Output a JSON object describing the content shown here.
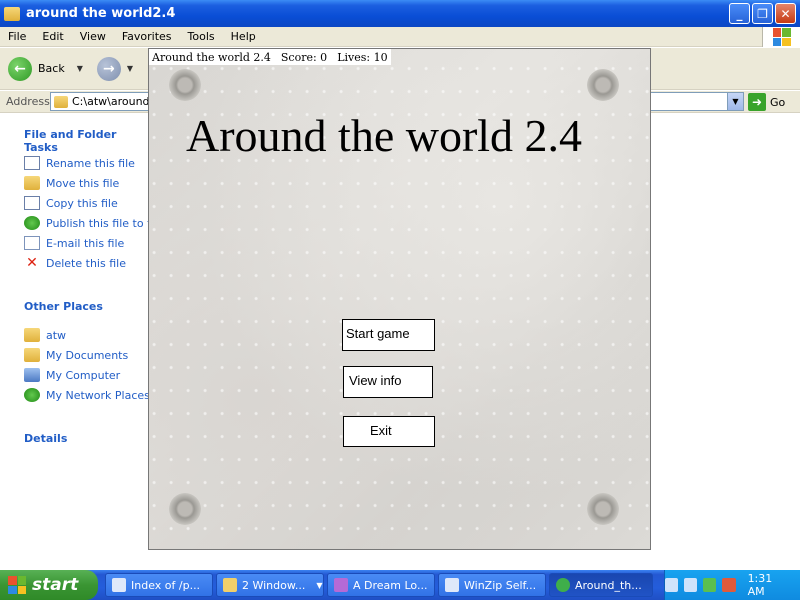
{
  "window": {
    "title": "around the world2.4",
    "controls": [
      "_",
      "❐",
      "✕"
    ]
  },
  "menubar": [
    "File",
    "Edit",
    "View",
    "Favorites",
    "Tools",
    "Help"
  ],
  "toolbar": {
    "back_label": "Back"
  },
  "address": {
    "label": "Address",
    "path": "C:\\atw\\around t",
    "go_label": "Go"
  },
  "sidebar": {
    "file_tasks_heading": "File and Folder Tasks",
    "file_tasks": [
      {
        "label": "Rename this file",
        "icon": "rename-icon"
      },
      {
        "label": "Move this file",
        "icon": "move-icon"
      },
      {
        "label": "Copy this file",
        "icon": "copy-icon"
      },
      {
        "label": "Publish this file to th",
        "icon": "publish-icon"
      },
      {
        "label": "E-mail this file",
        "icon": "email-icon"
      },
      {
        "label": "Delete this file",
        "icon": "delete-icon"
      }
    ],
    "other_places_heading": "Other Places",
    "other_places": [
      {
        "label": "atw",
        "icon": "folder-icon"
      },
      {
        "label": "My Documents",
        "icon": "my-documents-icon"
      },
      {
        "label": "My Computer",
        "icon": "my-computer-icon"
      },
      {
        "label": "My Network Places",
        "icon": "network-places-icon"
      }
    ],
    "details_heading": "Details"
  },
  "game": {
    "status": {
      "name": "Around the world 2.4",
      "score": "Score: 0",
      "lives": "Lives: 10"
    },
    "title": "Around the world 2.4",
    "buttons": {
      "start": "Start game",
      "info": "View info",
      "exit": "Exit"
    }
  },
  "taskbar": {
    "start_label": "start",
    "items": [
      {
        "label": "Index of /p...",
        "icon": "browser-icon"
      },
      {
        "label": "2 Window...",
        "icon": "folder-icon"
      },
      {
        "label": "A Dream Lo...",
        "icon": "app-icon"
      },
      {
        "label": "WinZip Self...",
        "icon": "winzip-icon"
      },
      {
        "label": "Around_th...",
        "icon": "globe-icon"
      }
    ],
    "clock": "1:31 AM"
  },
  "colors": {
    "xp_blue": "#0a4ed6",
    "link_blue": "#215dc6",
    "start_green": "#3a9533",
    "menubar_bg": "#ece9d8"
  }
}
